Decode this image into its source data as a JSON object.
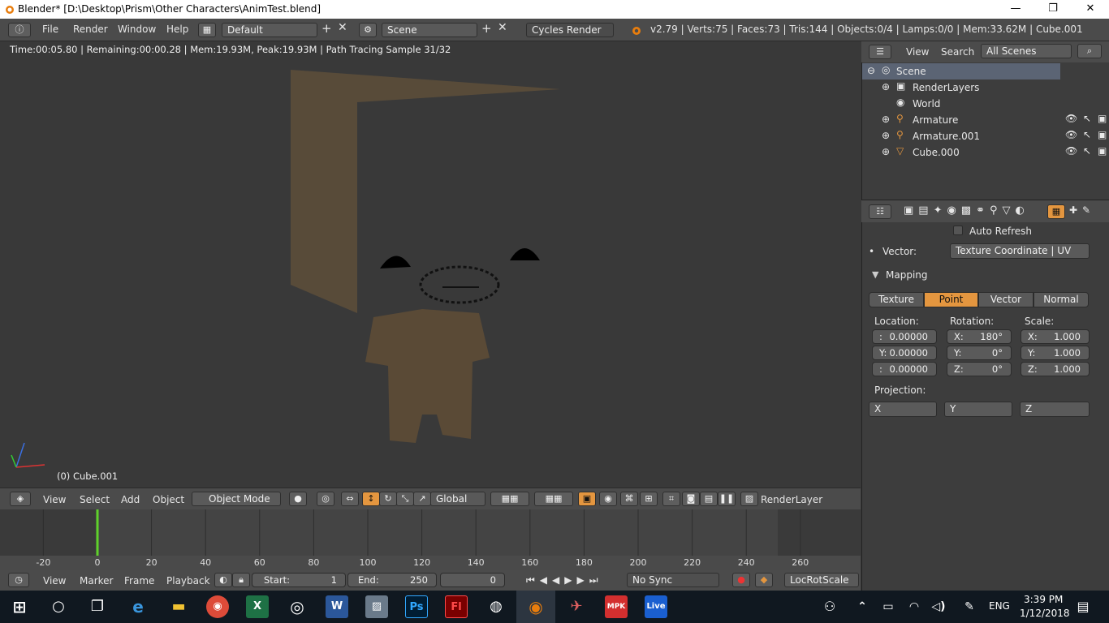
{
  "window": {
    "title": "Blender* [D:\\Desktop\\Prism\\Other Characters\\AnimTest.blend]",
    "min": "—",
    "max": "❐",
    "close": "✕"
  },
  "info": {
    "menus": [
      "File",
      "Render",
      "Window",
      "Help"
    ],
    "layout": "Default",
    "scene": "Scene",
    "engine": "Cycles Render",
    "stats": "v2.79 | Verts:75 | Faces:73 | Tris:144 | Objects:0/4 | Lamps:0/0 | Mem:33.62M | Cube.001"
  },
  "viewport": {
    "status": "Time:00:05.80 | Remaining:00:00.28 | Mem:19.93M, Peak:19.93M | Path Tracing Sample 31/32",
    "object_label": "(0) Cube.001",
    "header": {
      "view": "View",
      "select": "Select",
      "add": "Add",
      "object": "Object",
      "mode": "Object Mode",
      "orientation": "Global",
      "render_layer": "RenderLayer"
    }
  },
  "timeline": {
    "ticks": [
      "-20",
      "0",
      "20",
      "40",
      "60",
      "80",
      "100",
      "120",
      "140",
      "160",
      "180",
      "200",
      "220",
      "240",
      "260"
    ],
    "current_frame": 0,
    "header": {
      "view": "View",
      "marker": "Marker",
      "frame": "Frame",
      "playback": "Playback",
      "start_label": "Start:",
      "start": "1",
      "end_label": "End:",
      "end": "250",
      "current": "0",
      "sync": "No Sync",
      "keying": "LocRotScale"
    }
  },
  "outliner": {
    "view": "View",
    "search": "Search",
    "filter": "All Scenes",
    "rows": [
      {
        "label": "Scene"
      },
      {
        "label": "RenderLayers"
      },
      {
        "label": "World"
      },
      {
        "label": "Armature"
      },
      {
        "label": "Armature.001"
      },
      {
        "label": "Cube.000"
      }
    ]
  },
  "properties": {
    "auto_refresh": "Auto Refresh",
    "vector_label": "Vector:",
    "vector_value": "Texture Coordinate | UV",
    "mapping_title": "Mapping",
    "tabs": [
      "Texture",
      "Point",
      "Vector",
      "Normal"
    ],
    "active_tab": "Point",
    "location_label": "Location:",
    "rotation_label": "Rotation:",
    "scale_label": "Scale:",
    "location": [
      {
        "axis": ":",
        "value": "0.00000"
      },
      {
        "axis": "Y:",
        "value": "0.00000"
      },
      {
        "axis": ":",
        "value": "0.00000"
      }
    ],
    "rotation": [
      {
        "axis": "X:",
        "value": "180°"
      },
      {
        "axis": "Y:",
        "value": "0°"
      },
      {
        "axis": "Z:",
        "value": "0°"
      }
    ],
    "scale": [
      {
        "axis": "X:",
        "value": "1.000"
      },
      {
        "axis": "Y:",
        "value": "1.000"
      },
      {
        "axis": "Z:",
        "value": "1.000"
      }
    ],
    "projection_label": "Projection:",
    "projection": [
      "X",
      "Y",
      "Z"
    ]
  },
  "taskbar": {
    "apps": [
      "Ps",
      "Fl",
      "MPK",
      "Live"
    ],
    "lang": "ENG",
    "time": "3:39 PM",
    "date": "1/12/2018"
  },
  "colors": {
    "accent": "#e4963f",
    "frame_marker": "#5fd12b",
    "taskbar": "#101820"
  }
}
